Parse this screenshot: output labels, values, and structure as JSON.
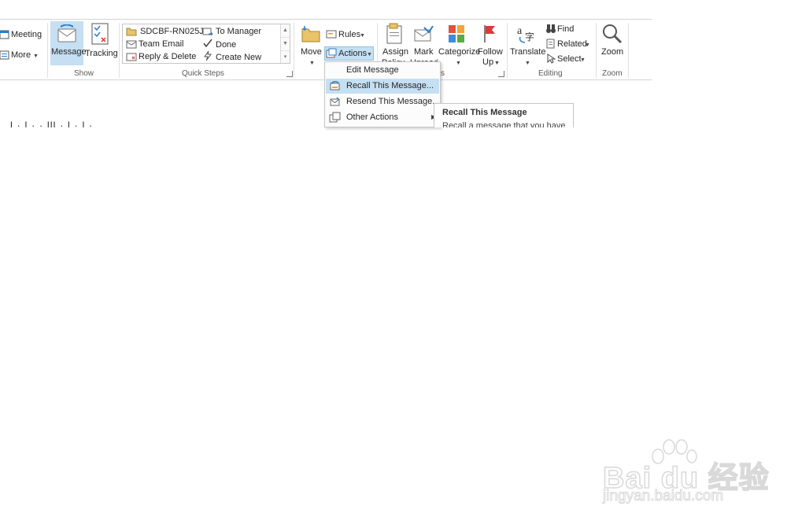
{
  "ribbon": {
    "respond": {
      "meeting_label": "Meeting",
      "more_label": "More"
    },
    "show": {
      "message_label": "Message",
      "tracking_label": "Tracking",
      "group_label": "Show"
    },
    "quick_steps": {
      "items": [
        {
          "label": "SDCBF-RN025J...",
          "icon": "folder-icon"
        },
        {
          "label": "Team Email",
          "icon": "mail-icon"
        },
        {
          "label": "Reply & Delete",
          "icon": "reply-delete-icon"
        },
        {
          "label": "To Manager",
          "icon": "forward-manager-icon"
        },
        {
          "label": "Done",
          "icon": "checkmark-icon"
        },
        {
          "label": "Create New",
          "icon": "lightning-icon"
        }
      ],
      "group_label": "Quick Steps"
    },
    "move": {
      "move_label": "Move",
      "rules_label": "Rules",
      "actions_label": "Actions"
    },
    "tags": {
      "assign_line1": "Assign",
      "assign_line2": "Policy",
      "mark_line1": "Mark",
      "mark_line2": "Unread",
      "categorize_label": "Categorize",
      "follow_line1": "Follow",
      "follow_line2": "Up",
      "group_label_partial": "s"
    },
    "editing": {
      "translate_label": "Translate",
      "find_label": "Find",
      "related_label": "Related",
      "select_label": "Select",
      "group_label": "Editing"
    },
    "zoom": {
      "zoom_label": "Zoom",
      "group_label": "Zoom"
    }
  },
  "actions_menu": {
    "items": [
      {
        "label": "Edit Message",
        "icon": "edit-icon",
        "highlighted": false,
        "has_submenu": false
      },
      {
        "label": "Recall This Message...",
        "icon": "recall-icon",
        "highlighted": true,
        "has_submenu": false
      },
      {
        "label": "Resend This Message...",
        "icon": "resend-icon",
        "highlighted": false,
        "has_submenu": false
      },
      {
        "label": "Other Actions",
        "icon": "other-actions-icon",
        "highlighted": false,
        "has_submenu": true
      }
    ]
  },
  "tooltip": {
    "title": "Recall This Message",
    "description": "Recall a message that you have"
  },
  "body_text_partial": "l · l · · lll · l · l ·",
  "watermark": {
    "brand": "Bai du 经验",
    "url": "jingyan.baidu.com"
  },
  "colors": {
    "highlight": "#c5dff3",
    "accent_blue": "#2b7cd3",
    "flag_red": "#d83b3b"
  }
}
